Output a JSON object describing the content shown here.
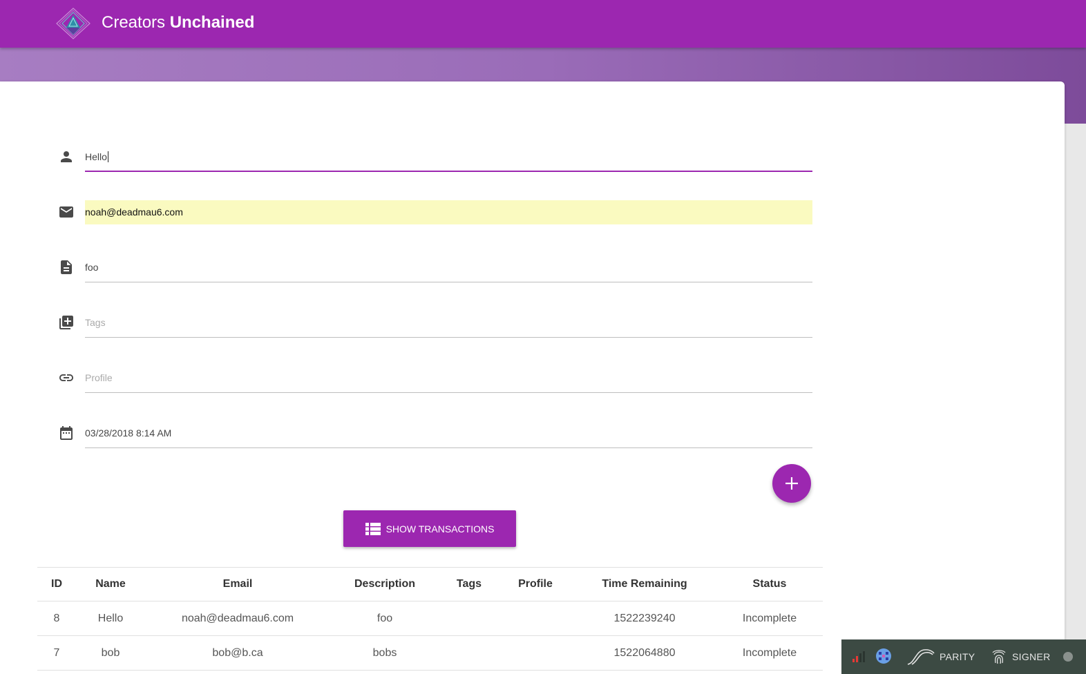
{
  "header": {
    "brand_light": "Creators",
    "brand_bold": "Unchained"
  },
  "form": {
    "name": {
      "value": "Hello",
      "icon": "person-icon"
    },
    "email": {
      "value": "noah@deadmau6.com",
      "icon": "email-icon"
    },
    "description": {
      "value": "foo",
      "icon": "description-icon"
    },
    "tags": {
      "value": "",
      "placeholder": "Tags",
      "icon": "library-add-icon"
    },
    "profile": {
      "value": "",
      "placeholder": "Profile",
      "icon": "link-icon"
    },
    "deadline": {
      "value": "03/28/2018 8:14 AM",
      "icon": "calendar-icon"
    }
  },
  "actions": {
    "show_transactions_label": "SHOW TRANSACTIONS"
  },
  "table": {
    "columns": [
      "ID",
      "Name",
      "Email",
      "Description",
      "Tags",
      "Profile",
      "Time Remaining",
      "Status"
    ],
    "rows": [
      [
        "8",
        "Hello",
        "noah@deadmau6.com",
        "foo",
        "",
        "",
        "1522239240",
        "Incomplete"
      ],
      [
        "7",
        "bob",
        "bob@b.ca",
        "bobs",
        "",
        "",
        "1522064880",
        "Incomplete"
      ]
    ]
  },
  "parity_bar": {
    "parity_label": "PARITY",
    "signer_label": "SIGNER"
  },
  "colors": {
    "primary": "#9c27b0",
    "autofill": "#fafac0",
    "parity_bg": "#3c4a43"
  }
}
